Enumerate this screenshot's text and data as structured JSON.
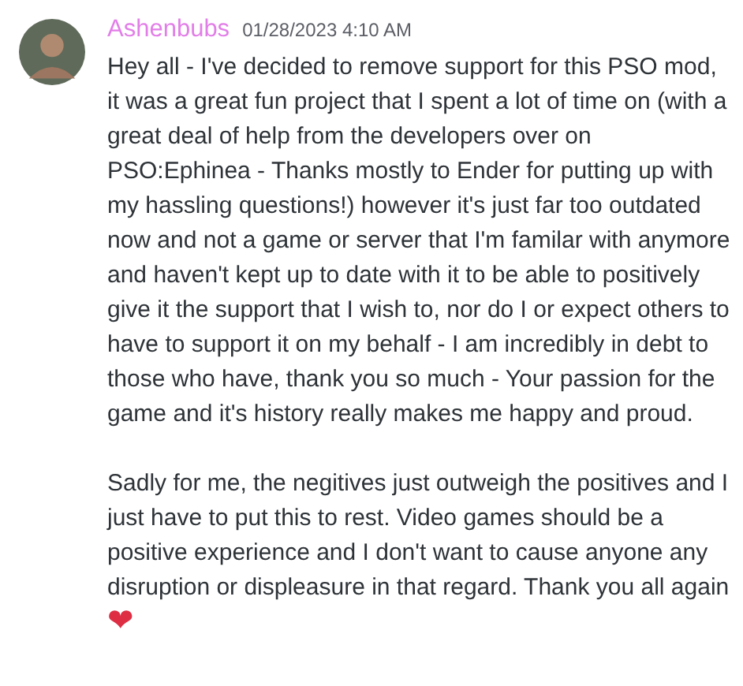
{
  "message": {
    "author": "Ashenbubs",
    "timestamp": "01/28/2023 4:10 AM",
    "paragraphs": [
      "Hey all - I've decided to remove support for this PSO mod, it was a great fun project that I spent a lot of time on (with a great deal of help from the developers over on PSO:Ephinea - Thanks mostly to Ender for putting up with my hassling questions!) however it's just far too outdated now and not a game or server that I'm familar with anymore and haven't kept up to date with it to be able to positively give it the support that I wish to, nor do I or expect others to have to support it on my behalf - I am incredibly in debt to those who have, thank you so much - Your passion for the game and it's history really makes me happy and proud.",
      "Sadly for me, the negitives just outweigh the positives and I just have to put this to rest. Video games should be a positive experience and I don't want to cause anyone any disruption or displeasure in that regard.  Thank you all again ❤"
    ]
  }
}
